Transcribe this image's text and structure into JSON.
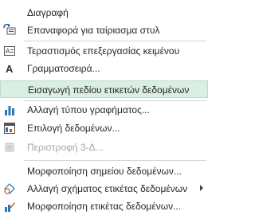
{
  "menu": {
    "items": [
      {
        "label": "Διαγραφή",
        "icon": "none",
        "disabled": false
      },
      {
        "label": "Επαναφορά για ταίριασμα στυλ",
        "icon": "reset-style-icon",
        "disabled": false
      },
      {
        "label": "Τεραστισμός επεξεργασίας κειμένου",
        "icon": "format-text-icon",
        "disabled": false
      },
      {
        "label": "Γραμματοσειρά...",
        "icon": "font-icon",
        "disabled": false
      },
      {
        "label": "Εισαγωγή πεδίου ετικετών δεδομένων",
        "icon": "none",
        "disabled": false,
        "highlighted": true
      },
      {
        "label": "Αλλαγή τύπου γραφήματος...",
        "icon": "bar-chart-icon",
        "disabled": false
      },
      {
        "label": "Επιλογή δεδομένων...",
        "icon": "select-data-icon",
        "disabled": false
      },
      {
        "label": "Περιστροφή 3-Δ...",
        "icon": "rotate-3d-icon",
        "disabled": true
      },
      {
        "label": "Μορφοποίηση σημείου δεδομένων...",
        "icon": "none",
        "disabled": false
      },
      {
        "label": "Αλλαγή σχήματος ετικέτας δεδομένων",
        "icon": "change-shape-icon",
        "disabled": false,
        "submenu": true
      },
      {
        "label": "Μορφοποίηση ετικέτας δεδομένων...",
        "icon": "format-label-icon",
        "disabled": false
      }
    ]
  },
  "colors": {
    "highlight": "#d9efe4",
    "highlight_border": "#b8dcc9",
    "text": "#262626",
    "disabled_text": "#a6a6a6"
  }
}
